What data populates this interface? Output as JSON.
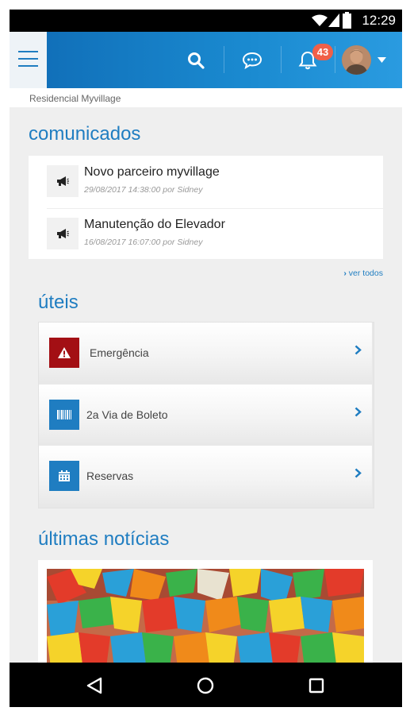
{
  "status_bar": {
    "time": "12:29"
  },
  "app_bar": {
    "menu_icon": "hamburger-icon",
    "search_icon": "search-icon",
    "chat_icon": "chat-bubble-icon",
    "notifications_icon": "bell-icon",
    "notifications_count": "43",
    "dropdown_icon": "caret-down-icon",
    "accent": "#1a8ad0",
    "badge_color": "#f06048"
  },
  "breadcrumb": "Residencial Myvillage",
  "comunicados": {
    "title": "comunicados",
    "items": [
      {
        "title": "Novo parceiro myvillage",
        "meta": "29/08/2017 14:38:00 por Sidney",
        "icon": "megaphone-icon"
      },
      {
        "title": "Manutenção do Elevador",
        "meta": "16/08/2017 16:07:00 por Sidney",
        "icon": "megaphone-icon"
      }
    ],
    "ver_todos": "ver todos"
  },
  "uteis": {
    "title": "úteis",
    "items": [
      {
        "label": "Emergência",
        "icon": "warning-icon",
        "color": "#a30f14"
      },
      {
        "label": "2a Via de Boleto",
        "icon": "barcode-icon",
        "color": "#1f7dc1"
      },
      {
        "label": "Reservas",
        "icon": "calendar-icon",
        "color": "#1f7dc1"
      }
    ]
  },
  "noticias": {
    "title": "últimas notícias"
  },
  "nav_bar": {
    "back_icon": "back-triangle-icon",
    "home_icon": "home-circle-icon",
    "recents_icon": "recents-square-icon"
  }
}
